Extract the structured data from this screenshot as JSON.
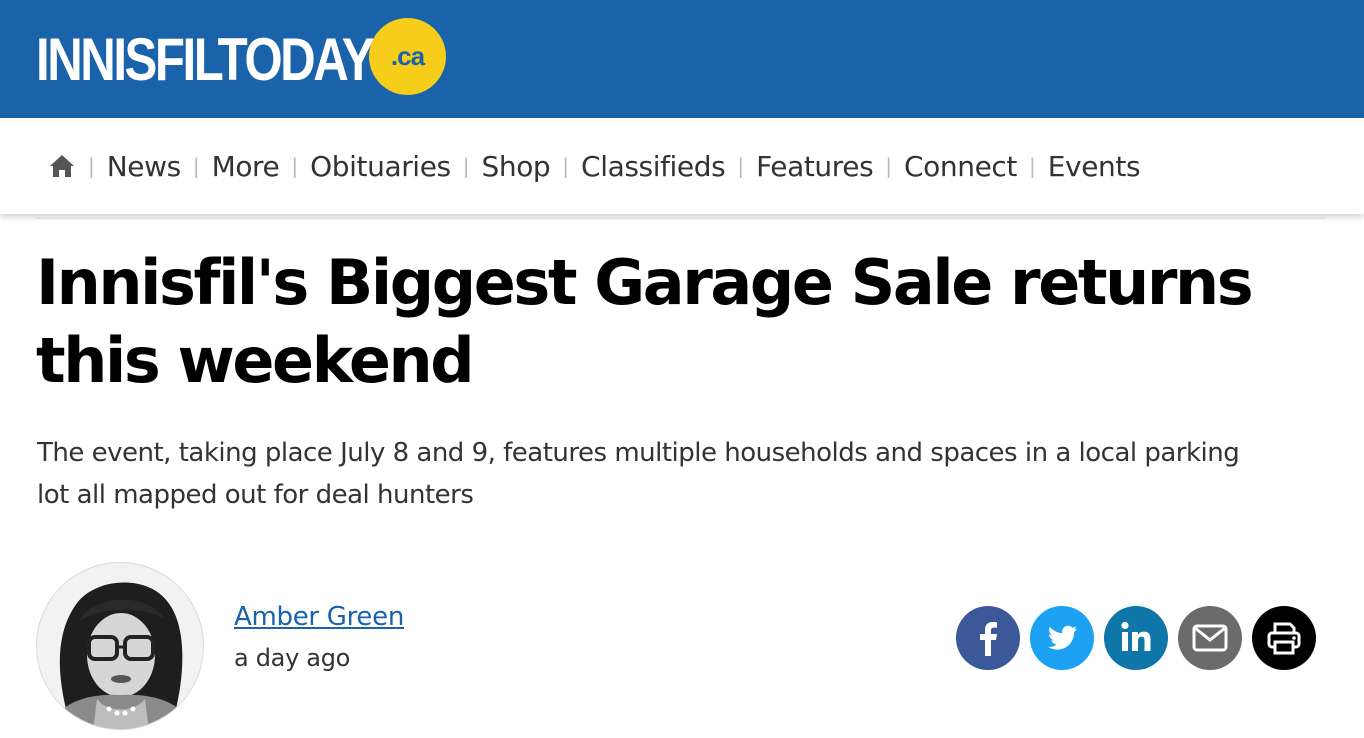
{
  "header": {
    "logo_text": "INNISFILTODAY",
    "logo_badge": ".ca",
    "bg_color": "#1a63aa",
    "badge_color": "#f6cd1a"
  },
  "nav": {
    "home_icon": "home-icon",
    "items": [
      "News",
      "More",
      "Obituaries",
      "Shop",
      "Classifieds",
      "Features",
      "Connect",
      "Events"
    ]
  },
  "article": {
    "headline": "Innisfil's Biggest Garage Sale returns this weekend",
    "dek": "The event, taking place July 8 and 9, features multiple households and spaces in a local parking lot all mapped out for deal hunters",
    "author": "Amber Green",
    "timestamp": "a day ago"
  },
  "share": {
    "buttons": [
      {
        "icon": "facebook-icon",
        "color": "#3b5998"
      },
      {
        "icon": "twitter-icon",
        "color": "#1da1f2"
      },
      {
        "icon": "linkedin-icon",
        "color": "#0e76a8"
      },
      {
        "icon": "email-icon",
        "color": "#6b6b6b"
      },
      {
        "icon": "print-icon",
        "color": "#000000"
      }
    ]
  }
}
